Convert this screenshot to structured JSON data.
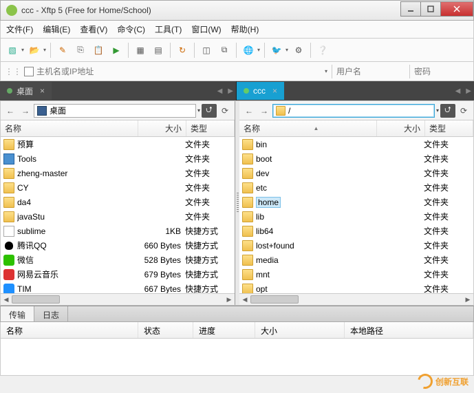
{
  "window": {
    "title": "ccc   - Xftp 5 (Free for Home/School)"
  },
  "menu": [
    "文件(F)",
    "编辑(E)",
    "查看(V)",
    "命令(C)",
    "工具(T)",
    "窗口(W)",
    "帮助(H)"
  ],
  "address": {
    "host_placeholder": "主机名或IP地址",
    "user_placeholder": "用户名",
    "pass_placeholder": "密码"
  },
  "tabs": {
    "left": "桌面",
    "right": "ccc"
  },
  "left": {
    "path": "桌面",
    "cols": {
      "name": "名称",
      "size": "大小",
      "type": "类型"
    },
    "items": [
      {
        "icon": "folder",
        "name": "预算",
        "size": "",
        "type": "文件夹"
      },
      {
        "icon": "desk",
        "name": "Tools",
        "size": "",
        "type": "文件夹"
      },
      {
        "icon": "folder",
        "name": "zheng-master",
        "size": "",
        "type": "文件夹"
      },
      {
        "icon": "folder",
        "name": "CY",
        "size": "",
        "type": "文件夹"
      },
      {
        "icon": "folder",
        "name": "da4",
        "size": "",
        "type": "文件夹"
      },
      {
        "icon": "folder",
        "name": "javaStu",
        "size": "",
        "type": "文件夹"
      },
      {
        "icon": "file",
        "name": "sublime",
        "size": "1KB",
        "type": "快捷方式"
      },
      {
        "icon": "qq",
        "name": "腾讯QQ",
        "size": "660 Bytes",
        "type": "快捷方式"
      },
      {
        "icon": "wechat",
        "name": "微信",
        "size": "528 Bytes",
        "type": "快捷方式"
      },
      {
        "icon": "netease",
        "name": "网易云音乐",
        "size": "679 Bytes",
        "type": "快捷方式"
      },
      {
        "icon": "tim",
        "name": "TIM",
        "size": "667 Bytes",
        "type": "快捷方式"
      }
    ]
  },
  "right": {
    "path": "/",
    "cols": {
      "name": "名称",
      "size": "大小",
      "type": "类型"
    },
    "selected": "home",
    "items": [
      {
        "icon": "folder",
        "name": "bin",
        "size": "",
        "type": "文件夹"
      },
      {
        "icon": "folder",
        "name": "boot",
        "size": "",
        "type": "文件夹"
      },
      {
        "icon": "folder",
        "name": "dev",
        "size": "",
        "type": "文件夹"
      },
      {
        "icon": "folder",
        "name": "etc",
        "size": "",
        "type": "文件夹"
      },
      {
        "icon": "folder",
        "name": "home",
        "size": "",
        "type": "文件夹"
      },
      {
        "icon": "folder",
        "name": "lib",
        "size": "",
        "type": "文件夹"
      },
      {
        "icon": "folder",
        "name": "lib64",
        "size": "",
        "type": "文件夹"
      },
      {
        "icon": "folder",
        "name": "lost+found",
        "size": "",
        "type": "文件夹"
      },
      {
        "icon": "folder",
        "name": "media",
        "size": "",
        "type": "文件夹"
      },
      {
        "icon": "folder",
        "name": "mnt",
        "size": "",
        "type": "文件夹"
      },
      {
        "icon": "folder",
        "name": "opt",
        "size": "",
        "type": "文件夹"
      }
    ]
  },
  "bottom_tabs": {
    "transfer": "传输",
    "log": "日志"
  },
  "trans_cols": {
    "name": "名称",
    "status": "状态",
    "progress": "进度",
    "size": "大小",
    "local": "本地路径"
  },
  "watermark": "创新互联"
}
